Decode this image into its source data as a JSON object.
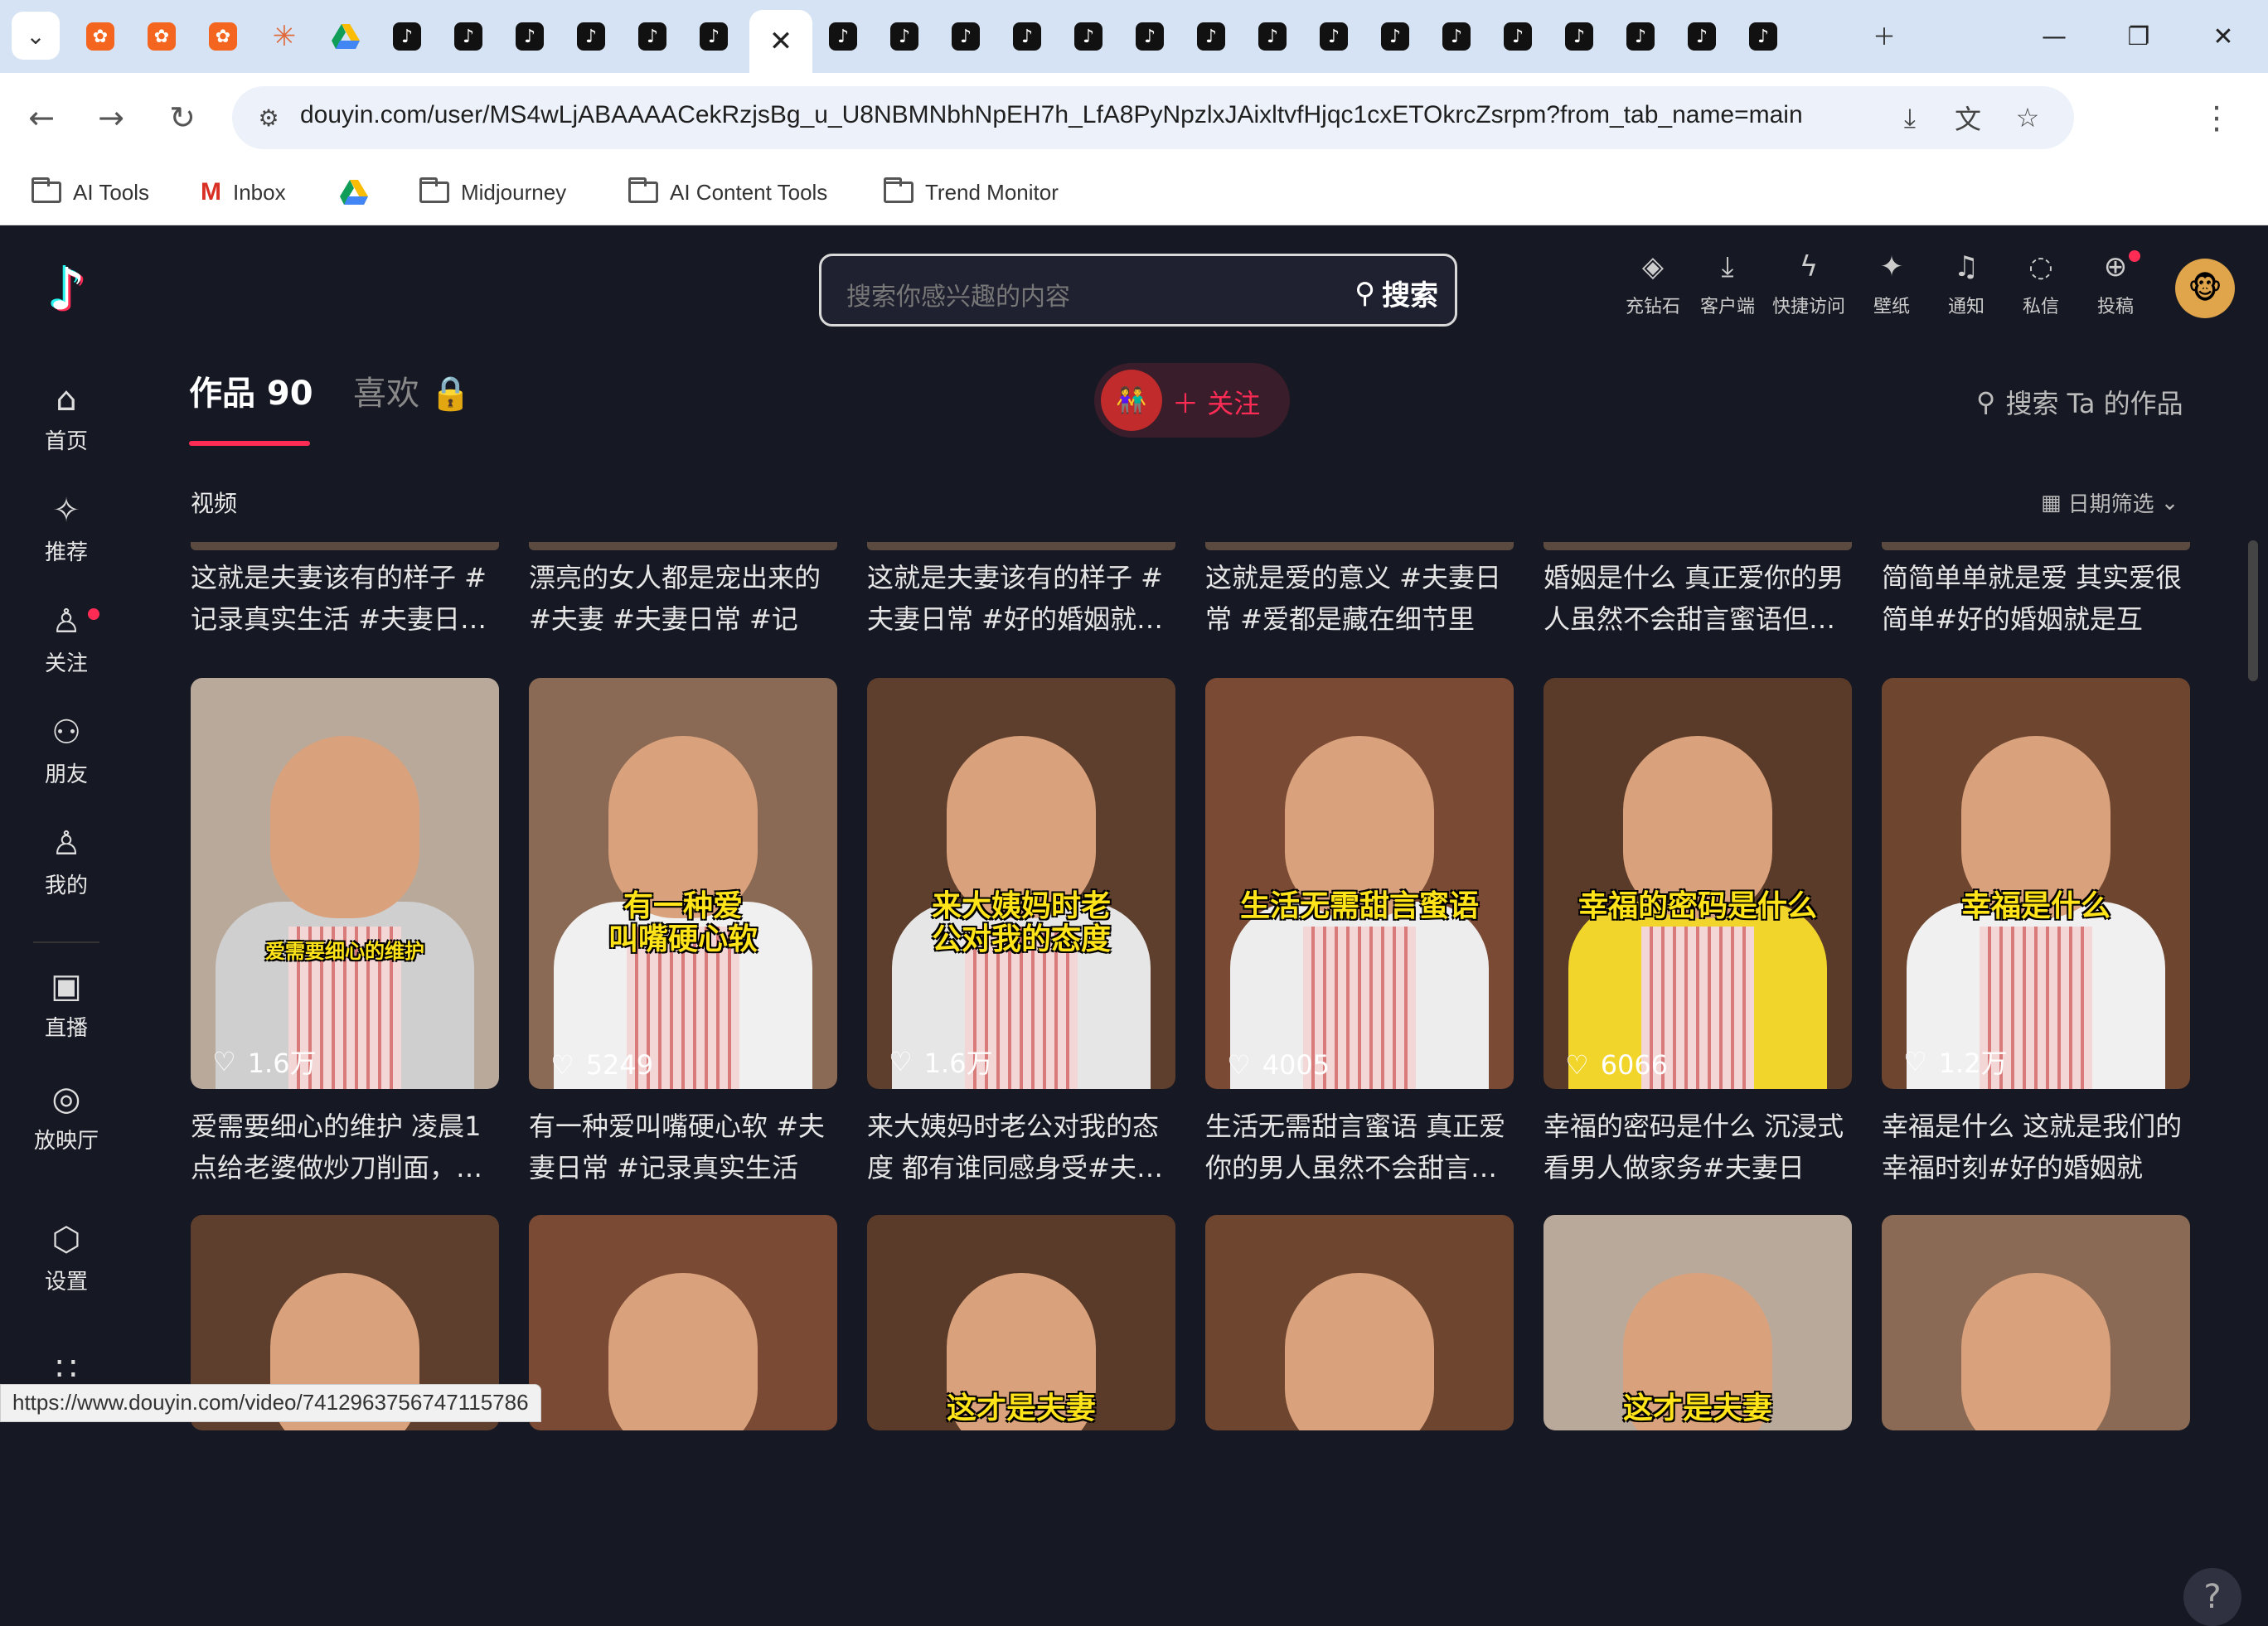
{
  "browser": {
    "tabs": [
      {
        "icon": "kiwi"
      },
      {
        "icon": "kiwi"
      },
      {
        "icon": "kiwi"
      },
      {
        "icon": "star"
      },
      {
        "icon": "gdrive"
      },
      {
        "icon": "douyin"
      },
      {
        "icon": "douyin"
      },
      {
        "icon": "douyin"
      },
      {
        "icon": "douyin"
      },
      {
        "icon": "douyin"
      },
      {
        "icon": "douyin"
      },
      {
        "icon": "close",
        "active": true
      },
      {
        "icon": "douyin"
      },
      {
        "icon": "douyin"
      },
      {
        "icon": "douyin"
      },
      {
        "icon": "douyin"
      },
      {
        "icon": "douyin"
      },
      {
        "icon": "douyin"
      },
      {
        "icon": "douyin"
      },
      {
        "icon": "douyin"
      },
      {
        "icon": "douyin"
      },
      {
        "icon": "douyin"
      },
      {
        "icon": "douyin"
      },
      {
        "icon": "douyin"
      },
      {
        "icon": "douyin"
      },
      {
        "icon": "douyin"
      },
      {
        "icon": "douyin"
      },
      {
        "icon": "douyin"
      }
    ],
    "url": "douyin.com/user/MS4wLjABAAAACekRzjsBg_u_U8NBMNbhNpEH7h_LfA8PyNpzlxJAixltvfHjqc1cxETOkrcZsrpm?from_tab_name=main",
    "bookmarks": [
      {
        "label": "AI Tools",
        "icon": "folder"
      },
      {
        "label": "Inbox",
        "icon": "gmail"
      },
      {
        "label": "",
        "icon": "gdrive"
      },
      {
        "label": "Midjourney",
        "icon": "folder"
      },
      {
        "label": "AI Content Tools",
        "icon": "folder"
      },
      {
        "label": "Trend Monitor",
        "icon": "folder"
      }
    ],
    "status_url": "https://www.douyin.com/video/7412963756747115786"
  },
  "sidebar": {
    "items": [
      {
        "label": "首页",
        "icon": "home-icon"
      },
      {
        "label": "推荐",
        "icon": "sparkle-icon"
      },
      {
        "label": "关注",
        "icon": "follow-icon",
        "dot": true
      },
      {
        "label": "朋友",
        "icon": "friends-icon"
      },
      {
        "label": "我的",
        "icon": "user-icon"
      },
      {
        "label": "直播",
        "icon": "tv-icon"
      },
      {
        "label": "放映厅",
        "icon": "cinema-icon"
      },
      {
        "label": "设置",
        "icon": "settings-icon"
      },
      {
        "label": "",
        "icon": "apps-icon"
      }
    ]
  },
  "header": {
    "search_placeholder": "搜索你感兴趣的内容",
    "search_button": "搜索",
    "actions": [
      {
        "label": "充钻石",
        "icon": "diamond-icon"
      },
      {
        "label": "客户端",
        "icon": "download-icon"
      },
      {
        "label": "快捷访问",
        "icon": "lightning-icon"
      },
      {
        "label": "壁纸",
        "icon": "wallpaper-icon"
      },
      {
        "label": "通知",
        "icon": "bell-icon"
      },
      {
        "label": "私信",
        "icon": "message-icon"
      },
      {
        "label": "投稿",
        "icon": "upload-icon",
        "dot": true
      }
    ]
  },
  "profile": {
    "tab_works": "作品 90",
    "tab_likes": "喜欢",
    "follow_label": "关注",
    "search_works": "搜索 Ta 的作品",
    "section_label": "视频",
    "date_filter": "日期筛选"
  },
  "videos_row1": [
    {
      "title": "这就是夫妻该有的样子 #记录真实生活 #夫妻日…"
    },
    {
      "title": "漂亮的女人都是宠出来的 #夫妻 #夫妻日常 #记录…"
    },
    {
      "title": "这就是夫妻该有的样子 #夫妻日常 #好的婚姻就…"
    },
    {
      "title": "这就是爱的意义 #夫妻日常 #爱都是藏在细节里 #…"
    },
    {
      "title": "婚姻是什么 真正爱你的男人虽然不会甜言蜜语但…"
    },
    {
      "title": "简简单单就是爱 其实爱很简单#好的婚姻就是互相…"
    }
  ],
  "videos_row2": [
    {
      "caption": "爱需要细心的维护",
      "likes": "1.6万",
      "title": "爱需要细心的维护 凌晨1点给老婆做炒刀削面，…"
    },
    {
      "caption": "有一种爱\n叫嘴硬心软",
      "likes": "5249",
      "title": "有一种爱叫嘴硬心软 #夫妻日常 #记录真实生活 #…"
    },
    {
      "caption": "来大姨妈时老\n公对我的态度",
      "likes": "1.6万",
      "title": "来大姨妈时老公对我的态度 都有谁同感身受#夫…"
    },
    {
      "caption": "生活无需甜言蜜语",
      "likes": "4005",
      "title": "生活无需甜言蜜语 真正爱你的男人虽然不会甜言…"
    },
    {
      "caption": "幸福的密码是什么",
      "likes": "6066",
      "title": "幸福的密码是什么 沉浸式看男人做家务#夫妻日常…"
    },
    {
      "caption": "幸福是什么",
      "likes": "1.2万",
      "title": "幸福是什么 这就是我们的幸福时刻#好的婚姻就是…"
    }
  ],
  "videos_row3": [
    {
      "caption": ""
    },
    {
      "caption": ""
    },
    {
      "caption": "这才是夫妻"
    },
    {
      "caption": ""
    },
    {
      "caption": "这才是夫妻"
    },
    {
      "caption": ""
    }
  ],
  "colors": {
    "bg": "#161823",
    "accent": "#fe2c55",
    "caption": "#ffe41a"
  }
}
